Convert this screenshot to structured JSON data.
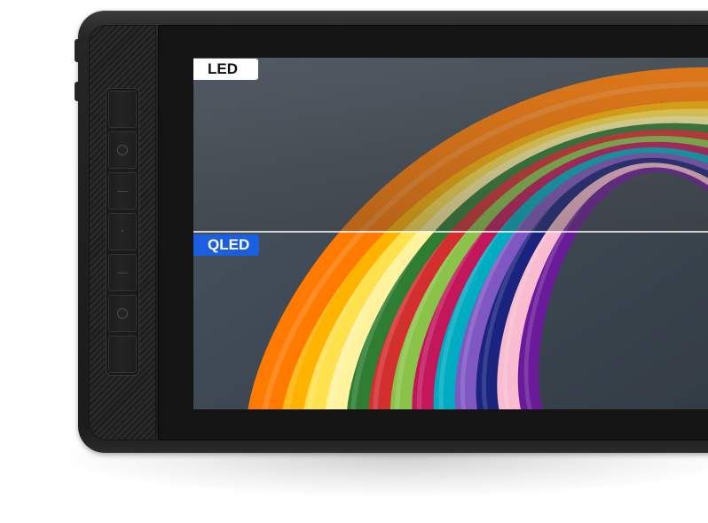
{
  "labels": {
    "top": "LED",
    "bottom": "QLED"
  },
  "colors": {
    "qled_badge": "#1a5fe0",
    "led_badge": "#ffffff",
    "screen_background": "#3f4a55",
    "device_body": "#1f1f1f"
  },
  "device": {
    "express_keys": 6,
    "key_marks": [
      "blank",
      "circle",
      "line",
      "dot",
      "line",
      "circle",
      "blank"
    ]
  },
  "ribbon_colors": [
    "#ff7a00",
    "#ffb300",
    "#ffe14d",
    "#fff3a0",
    "#2e7d32",
    "#d32f2f",
    "#8bc34a",
    "#c2185b",
    "#00acc1",
    "#7e57c2",
    "#1a237e",
    "#f8bbd0",
    "#6a1b9a"
  ]
}
